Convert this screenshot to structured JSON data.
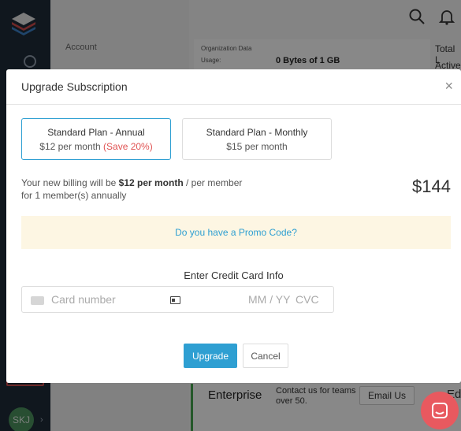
{
  "background": {
    "subnav": {
      "account_label": "Account"
    },
    "org": {
      "org_data_label": "Organization Data",
      "usage_label": "Usage:",
      "usage_value": "0 Bytes of 1 GB",
      "total_label": "Total L",
      "active_label": "Active"
    },
    "enterprise": {
      "title": "Enterprise",
      "description": "Contact us for teams over 50.",
      "email_button": "Email Us",
      "next_label": "Ed"
    },
    "user": {
      "initials": "SKJ"
    }
  },
  "modal": {
    "title": "Upgrade Subscription",
    "close": "×",
    "plans": [
      {
        "name": "Standard Plan - Annual",
        "price": "$12 per month",
        "save": "(Save 20%)",
        "selected": true
      },
      {
        "name": "Standard Plan - Monthly",
        "price": "$15 per month",
        "save": "",
        "selected": false
      }
    ],
    "billing": {
      "prefix": "Your new billing will be",
      "amount": "$12 per month",
      "suffix": "/ per member",
      "line2": "for 1 member(s) annually"
    },
    "total": "$144",
    "promo_link": "Do you have a Promo Code?",
    "credit_card": {
      "label": "Enter Credit Card Info",
      "number_placeholder": "Card number",
      "expiry_placeholder": "MM / YY",
      "cvc_placeholder": "CVC"
    },
    "buttons": {
      "upgrade": "Upgrade",
      "cancel": "Cancel"
    }
  },
  "colors": {
    "accent": "#2e9fd2",
    "save_red": "#e05353",
    "promo_bg": "#fdf6e3",
    "sidebar": "#1e2a37",
    "chat": "#e8595f",
    "enterprise_green": "#44a04d"
  }
}
